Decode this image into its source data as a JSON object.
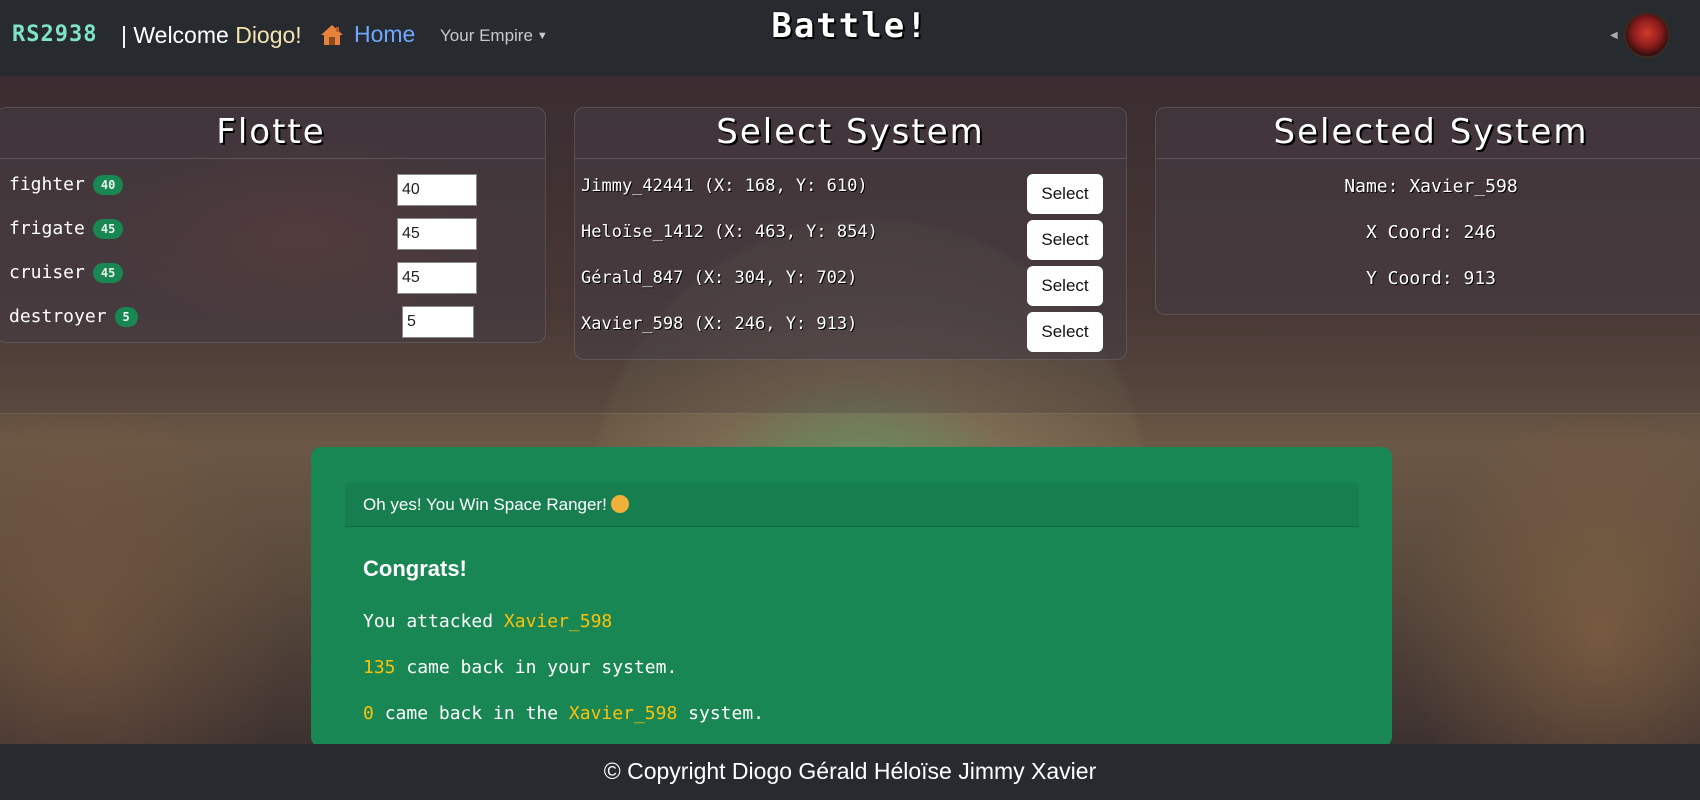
{
  "navbar": {
    "brand": "RS2938",
    "welcome_prefix": "| Welcome",
    "user_name": "Diogo!",
    "home_label": "Home",
    "empire_label": "Your Empire",
    "page_title": "Battle!",
    "avatar_alt": "user avatar"
  },
  "fleet": {
    "title": "Flotte",
    "ships": [
      {
        "name": "fighter",
        "count": "40",
        "input": "40"
      },
      {
        "name": "frigate",
        "count": "45",
        "input": "45"
      },
      {
        "name": "cruiser",
        "count": "45",
        "input": "45"
      },
      {
        "name": "destroyer",
        "count": "5",
        "input": "5"
      }
    ]
  },
  "systems": {
    "title": "Select System",
    "select_label": "Select",
    "list": [
      "Jimmy_42441 (X: 168, Y: 610)",
      "Heloïse_1412 (X: 463, Y: 854)",
      "Gérald_847 (X: 304, Y: 702)",
      "Xavier_598 (X: 246, Y: 913)"
    ]
  },
  "selected": {
    "title": "Selected System",
    "name_line": "Name: Xavier_598",
    "x_line": "X Coord: 246",
    "y_line": "Y Coord: 913"
  },
  "result": {
    "header": "Oh yes! You Win Space Ranger!",
    "congrats": "Congrats!",
    "attacked_prefix": "You attacked",
    "attacked_target": "Xavier_598",
    "returned_count": "135",
    "returned_text": "came back in your system.",
    "enemy_count": "0",
    "enemy_text_prefix": "came back in the",
    "enemy_target": "Xavier_598",
    "enemy_text_suffix": "system."
  },
  "footer": {
    "copyright": "© Copyright Diogo Gérald Héloïse Jimmy Xavier"
  },
  "colors": {
    "success": "#198754",
    "highlight": "#ffc107",
    "link": "#6ea8fe",
    "navbar": "#272b30"
  }
}
